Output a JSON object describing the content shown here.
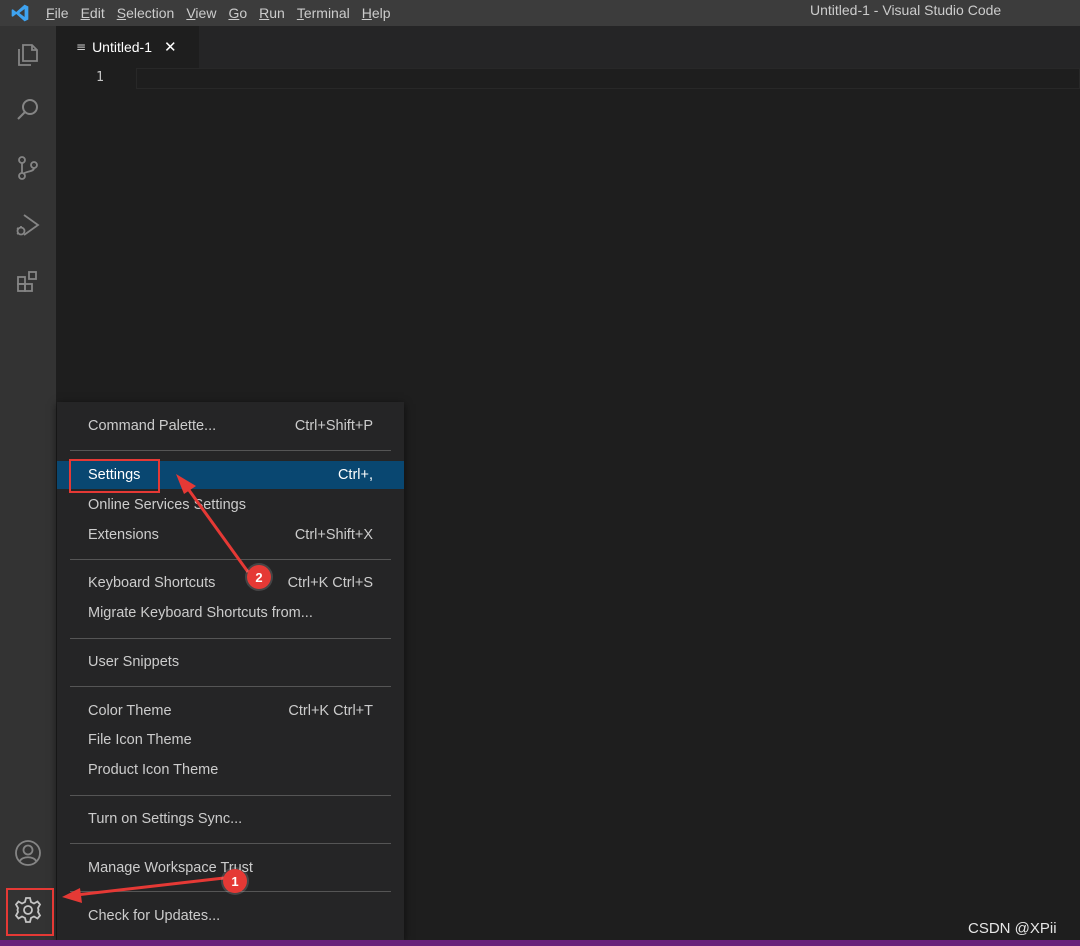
{
  "window": {
    "title": "Untitled-1 - Visual Studio Code"
  },
  "menubar": {
    "items": [
      {
        "mn": "F",
        "rest": "ile"
      },
      {
        "mn": "E",
        "rest": "dit"
      },
      {
        "mn": "S",
        "rest": "election"
      },
      {
        "mn": "V",
        "rest": "iew"
      },
      {
        "mn": "G",
        "rest": "o"
      },
      {
        "mn": "R",
        "rest": "un"
      },
      {
        "mn": "T",
        "rest": "erminal"
      },
      {
        "mn": "H",
        "rest": "elp"
      }
    ]
  },
  "activity_bar": {
    "icons": [
      "explorer-icon",
      "search-icon",
      "source-control-icon",
      "run-debug-icon",
      "extensions-icon",
      "account-icon",
      "manage-gear-icon"
    ]
  },
  "tab": {
    "label": "Untitled-1",
    "file_icon": "≡",
    "close_icon": "✕"
  },
  "editor": {
    "line_number": "1"
  },
  "context_menu": {
    "items": [
      {
        "label": "Command Palette...",
        "shortcut": "Ctrl+Shift+P"
      },
      {
        "label": "Settings",
        "shortcut": "Ctrl+,",
        "active": true
      },
      {
        "label": "Online Services Settings",
        "shortcut": ""
      },
      {
        "label": "Extensions",
        "shortcut": "Ctrl+Shift+X"
      },
      {
        "label": "Keyboard Shortcuts",
        "shortcut": "Ctrl+K Ctrl+S"
      },
      {
        "label": "Migrate Keyboard Shortcuts from...",
        "shortcut": ""
      },
      {
        "label": "User Snippets",
        "shortcut": ""
      },
      {
        "label": "Color Theme",
        "shortcut": "Ctrl+K Ctrl+T"
      },
      {
        "label": "File Icon Theme",
        "shortcut": ""
      },
      {
        "label": "Product Icon Theme",
        "shortcut": ""
      },
      {
        "label": "Turn on Settings Sync...",
        "shortcut": ""
      },
      {
        "label": "Manage Workspace Trust",
        "shortcut": ""
      },
      {
        "label": "Check for Updates...",
        "shortcut": ""
      }
    ]
  },
  "annotations": {
    "badge_1": "1",
    "badge_2": "2",
    "color": "#e53935"
  },
  "watermark": "CSDN @XPii",
  "colors": {
    "titlebar": "#3c3c3c",
    "activitybar": "#333333",
    "editor": "#1e1e1e",
    "menu": "#252526",
    "menu_active": "#094771",
    "statusbar": "#68217a",
    "vscode_blue": "#3ea3f0"
  }
}
